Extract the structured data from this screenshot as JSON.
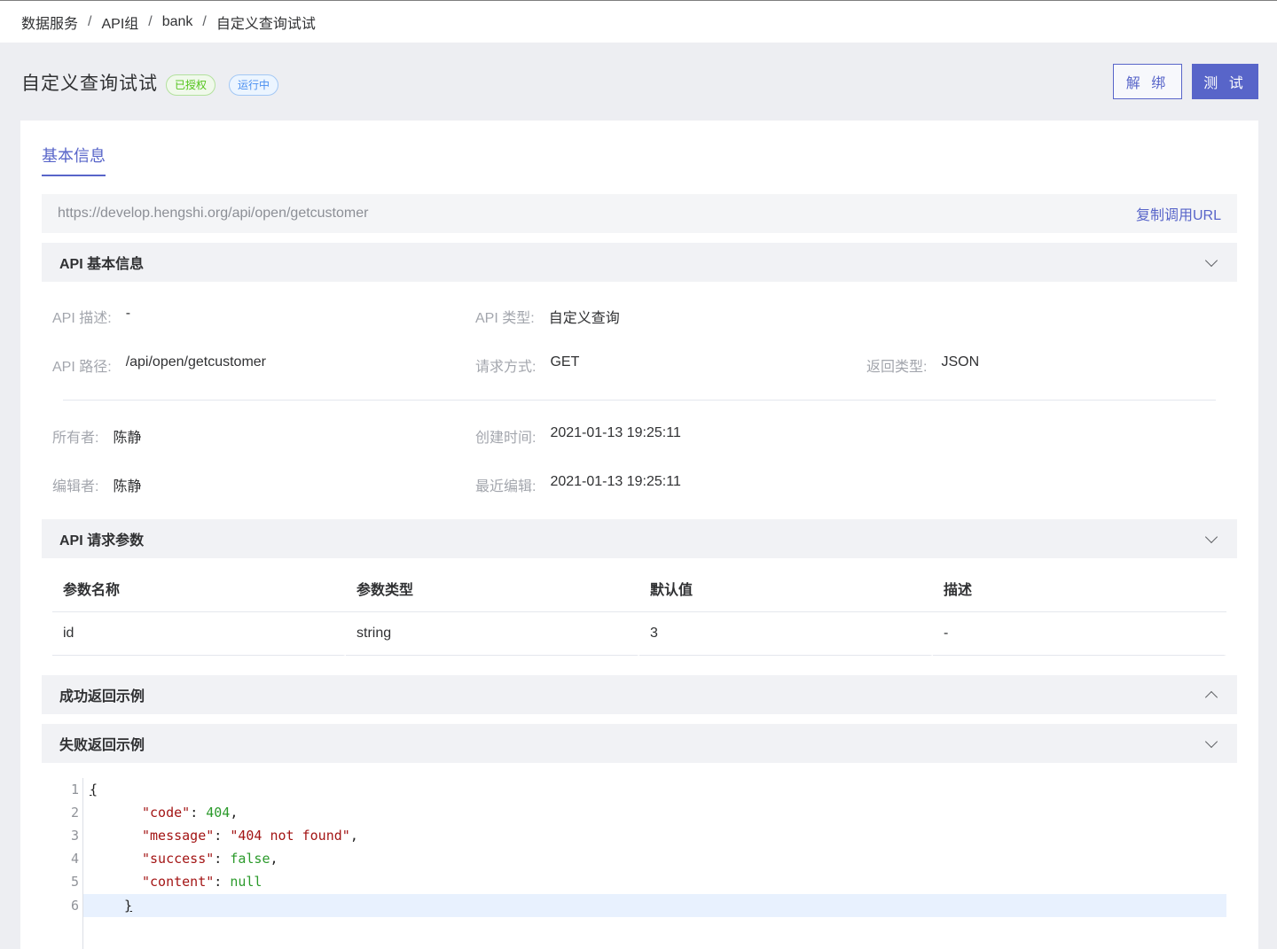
{
  "breadcrumb": [
    "数据服务",
    "API组",
    "bank",
    "自定义查询试试"
  ],
  "breadcrumb_separator": "/",
  "page": {
    "title": "自定义查询试试",
    "tags": {
      "authorized": "已授权",
      "running": "运行中"
    },
    "unbind_label": "解 绑",
    "test_label": "测 试"
  },
  "tab": {
    "label": "基本信息"
  },
  "url_bar": {
    "url": "https://develop.hengshi.org/api/open/getcustomer",
    "copy_label": "复制调用URL"
  },
  "sections": {
    "basic": {
      "title": "API 基本信息",
      "collapsed": false
    },
    "params": {
      "title": "API 请求参数",
      "collapsed": false
    },
    "success": {
      "title": "成功返回示例",
      "collapsed": true
    },
    "failure": {
      "title": "失败返回示例",
      "collapsed": false
    }
  },
  "basic_info": {
    "desc": {
      "label": "API 描述:",
      "value": "-"
    },
    "type": {
      "label": "API 类型:",
      "value": "自定义查询"
    },
    "path": {
      "label": "API 路径:",
      "value": "/api/open/getcustomer"
    },
    "method": {
      "label": "请求方式:",
      "value": "GET"
    },
    "return_type": {
      "label": "返回类型:",
      "value": "JSON"
    },
    "owner": {
      "label": "所有者:",
      "value": "陈静"
    },
    "created": {
      "label": "创建时间:",
      "value": "2021-01-13 19:25:11"
    },
    "editor": {
      "label": "编辑者:",
      "value": "陈静"
    },
    "modified": {
      "label": "最近编辑:",
      "value": "2021-01-13 19:25:11"
    }
  },
  "params_table": {
    "headers": [
      "参数名称",
      "参数类型",
      "默认值",
      "描述"
    ],
    "rows": [
      [
        "id",
        "string",
        "3",
        "-"
      ]
    ]
  },
  "failure_example": {
    "line_numbers": [
      "1",
      "2",
      "3",
      "4",
      "5",
      "6"
    ],
    "open_brace": "{",
    "close_brace": "}",
    "entries": [
      {
        "key": "\"code\"",
        "value": "404",
        "comma": ","
      },
      {
        "key": "\"message\"",
        "value": "\"404 not found\"",
        "comma": ","
      },
      {
        "key": "\"success\"",
        "value": "false",
        "comma": ","
      },
      {
        "key": "\"content\"",
        "value": "null",
        "comma": ""
      }
    ]
  }
}
